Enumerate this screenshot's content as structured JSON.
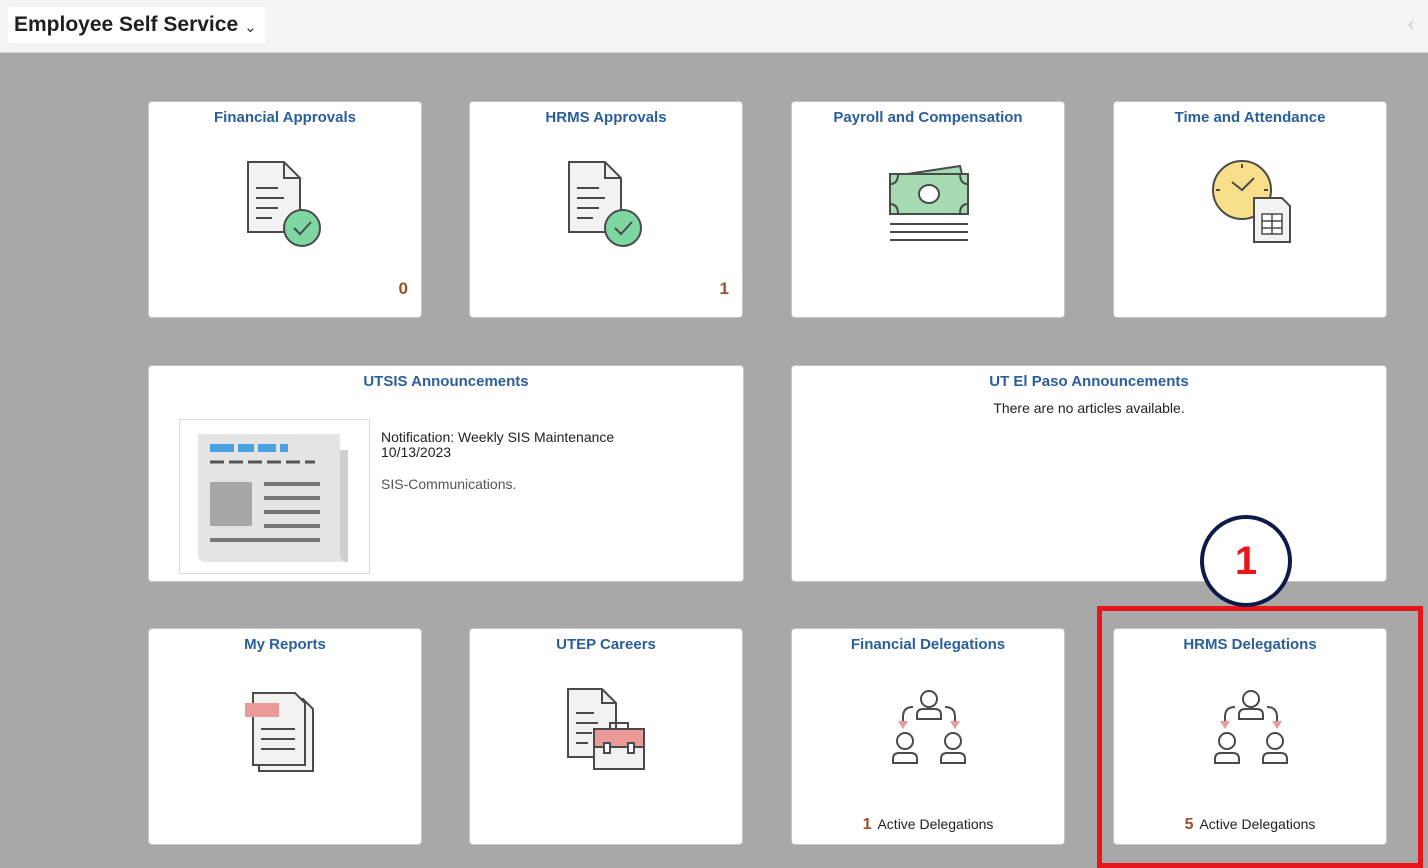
{
  "header": {
    "title": "Employee Self Service",
    "chevron_icon": "chevron-down-icon",
    "back_icon": "chevron-left-icon"
  },
  "tiles": {
    "financial_approvals": {
      "title": "Financial Approvals",
      "count": "0",
      "icon": "document-check-icon"
    },
    "hrms_approvals": {
      "title": "HRMS Approvals",
      "count": "1",
      "icon": "document-check-icon"
    },
    "payroll": {
      "title": "Payroll and Compensation",
      "icon": "money-icon"
    },
    "time_attendance": {
      "title": "Time and Attendance",
      "icon": "clock-timesheet-icon"
    },
    "utsis_announcements": {
      "title": "UTSIS Announcements",
      "icon": "newspaper-icon",
      "article_title": "Notification: Weekly SIS Maintenance 10/13/2023",
      "article_source": "SIS-Communications."
    },
    "utep_announcements": {
      "title": "UT El Paso Announcements",
      "empty_text": "There are no articles available."
    },
    "my_reports": {
      "title": "My Reports",
      "icon": "reports-icon"
    },
    "utep_careers": {
      "title": "UTEP Careers",
      "icon": "briefcase-document-icon"
    },
    "financial_delegations": {
      "title": "Financial Delegations",
      "icon": "delegation-icon",
      "count": "1",
      "label": "Active Delegations"
    },
    "hrms_delegations": {
      "title": "HRMS Delegations",
      "icon": "delegation-icon",
      "count": "5",
      "label": "Active Delegations"
    }
  },
  "annotation": {
    "step": "1"
  },
  "colors": {
    "background": "#a8a8a8",
    "tile_title": "#2a5e9c",
    "count": "#9a5224",
    "highlight": "#e8151a",
    "step_border": "#0e1a4a",
    "money_green": "#a6dbb2",
    "check_green": "#7ed7a0",
    "clock_yellow": "#f7de8a",
    "accent_pink": "#eb9a9a",
    "news_blue": "#4da3e0"
  }
}
